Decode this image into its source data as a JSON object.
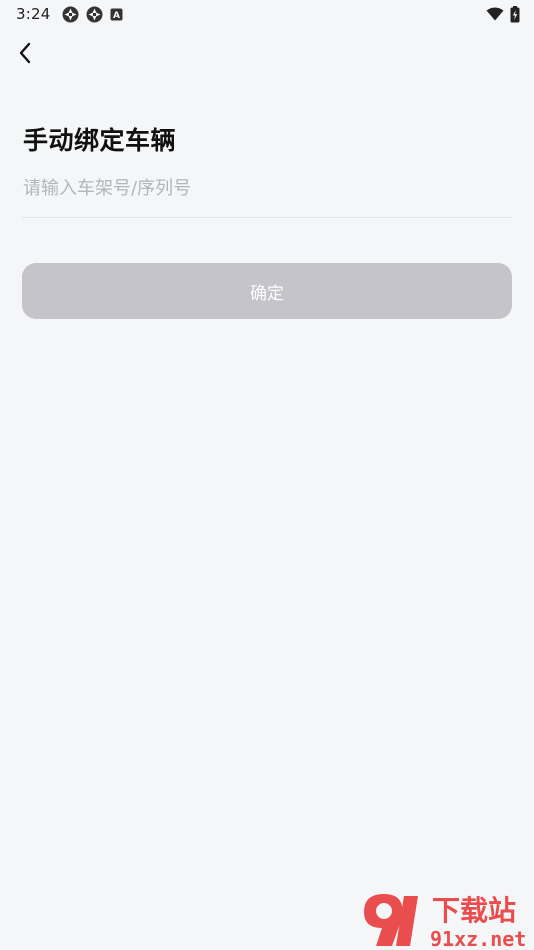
{
  "status_bar": {
    "time": "3:24",
    "icons_left": [
      "app-notification-icon",
      "app-notification-icon",
      "a-badge-icon"
    ],
    "icons_right": [
      "wifi-icon",
      "battery-charging-icon"
    ],
    "badge_letter": "A"
  },
  "nav": {
    "back_icon": "chevron-left-icon"
  },
  "page": {
    "title": "手动绑定车辆"
  },
  "vin_field": {
    "placeholder": "请输入车架号/序列号",
    "value": ""
  },
  "confirm_button": {
    "label": "确定",
    "enabled": false
  },
  "watermark": {
    "logo_text": "91",
    "brand": "下载站",
    "url": "91xz.net"
  },
  "colors": {
    "background": "#f5f6f8",
    "button_disabled": "#c4c4ca",
    "placeholder": "#b3b5ba",
    "watermark_red": "#e83b3b"
  }
}
